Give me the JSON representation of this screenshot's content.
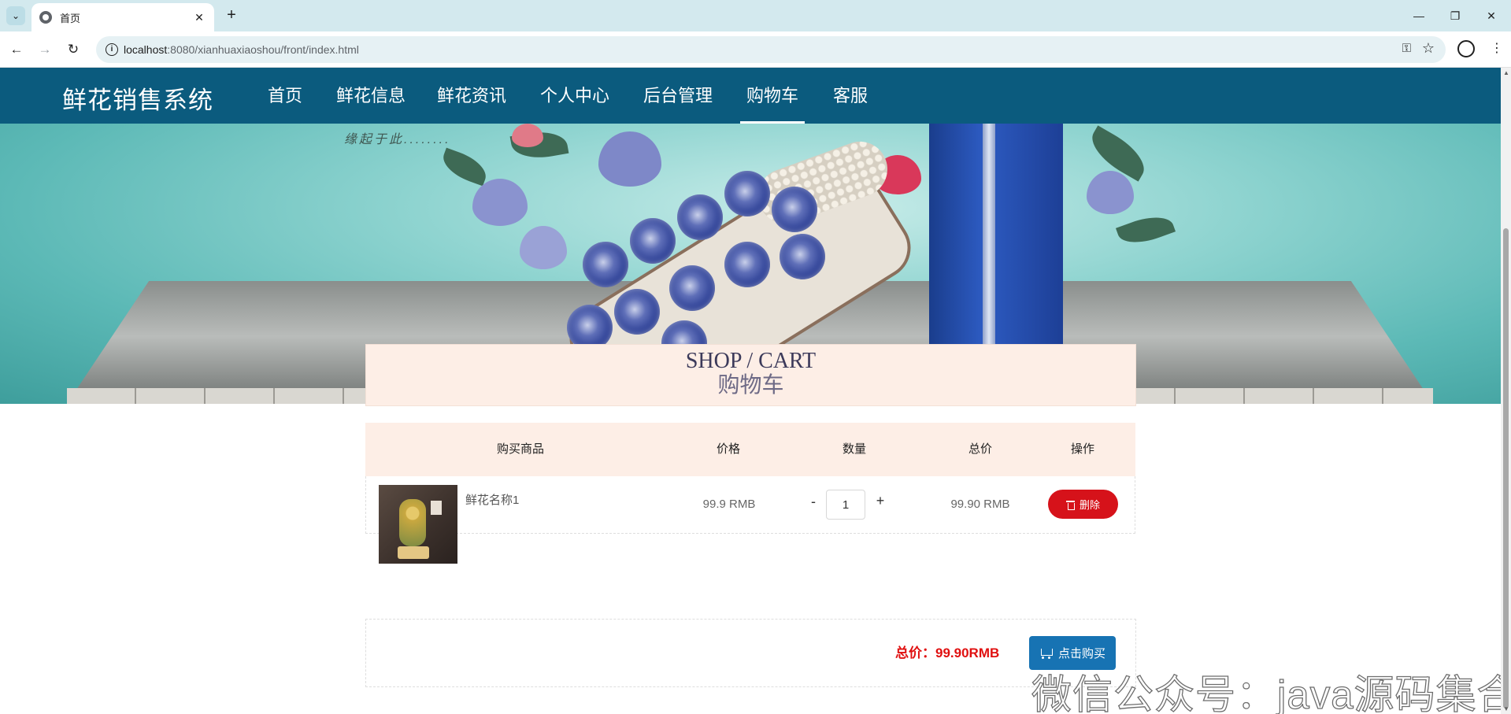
{
  "browser": {
    "tab_title": "首页",
    "tab_close": "✕",
    "new_tab": "+",
    "url_host": "localhost",
    "url_path": ":8080/xianhuaxiaoshou/front/index.html",
    "window_controls": [
      "—",
      "❐",
      "✕"
    ],
    "nav": {
      "back": "←",
      "forward": "→",
      "reload": "↻"
    },
    "icons": [
      "tab-search-icon",
      "globe-icon",
      "info-icon",
      "key-icon",
      "star-icon",
      "profile-icon",
      "menu-icon"
    ]
  },
  "site": {
    "logo": "鲜花销售系统",
    "nav": [
      {
        "label": "首页",
        "active": false
      },
      {
        "label": "鲜花信息",
        "active": false
      },
      {
        "label": "鲜花资讯",
        "active": false
      },
      {
        "label": "个人中心",
        "active": false
      },
      {
        "label": "后台管理",
        "active": false
      },
      {
        "label": "购物车",
        "active": true
      },
      {
        "label": "客服",
        "active": false
      }
    ],
    "header_color": "#0b5b7e"
  },
  "banner": {
    "tagline": "缘起于此........",
    "slides": 3,
    "active_slide": 2
  },
  "cart": {
    "title_en": "SHOP / CART",
    "title_cn": "购物车",
    "columns": [
      "购买商品",
      "价格",
      "数量",
      "总价",
      "操作"
    ],
    "items": [
      {
        "name": "鲜花名称1",
        "price": "99.9 RMB",
        "qty_minus": "-",
        "quantity": "1",
        "qty_plus": "+",
        "subtotal": "99.90 RMB",
        "delete_label": "删除"
      }
    ],
    "total_label": "总价：99.90RMB",
    "buy_label": "点击购买",
    "accent_red": "#d6121a",
    "accent_blue": "#1773b3"
  },
  "watermark": "微信公众号：java源码集合"
}
